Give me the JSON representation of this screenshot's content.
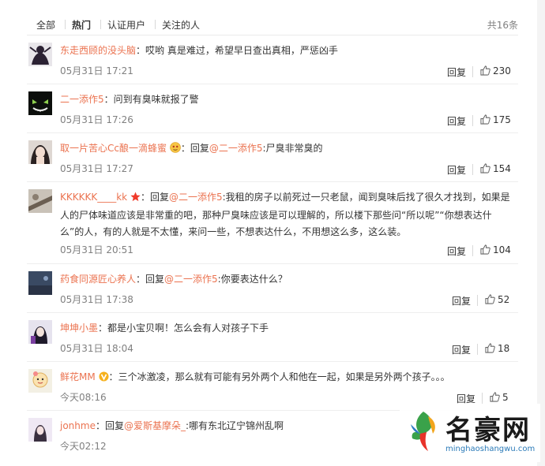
{
  "tabs": [
    {
      "label": "全部"
    },
    {
      "label": "热门"
    },
    {
      "label": "认证用户"
    },
    {
      "label": "关注的人"
    }
  ],
  "total_count": "共16条",
  "reply_label": "回复",
  "comments": [
    {
      "user": "东走西顾的没头脑",
      "prefix": "：",
      "reply_to": "",
      "text": "哎哟 真是难过，希望早日查出真相，严惩凶手",
      "time": "05月31日 17:21",
      "likes": "230",
      "badge": ""
    },
    {
      "user": "二一添作5",
      "prefix": "：",
      "reply_to": "",
      "text": "问到有臭味就报了警",
      "time": "05月31日 17:26",
      "likes": "175",
      "badge": ""
    },
    {
      "user": "取一片苦心Cc酿一滴蜂蜜",
      "prefix": "：回复",
      "reply_to": "@二一添作5",
      "text": ":尸臭非常臭的",
      "time": "05月31日 17:27",
      "likes": "154",
      "badge": "emoji"
    },
    {
      "user": "KKKKKK____kk",
      "prefix": "：回复",
      "reply_to": "@二一添作5",
      "text": ":我租的房子以前死过一只老鼠，闻到臭味后找了很久才找到，如果是人的尸体味道应该是非常重的吧，那种尸臭味应该是可以理解的，所以楼下那些问“所以呢”“你想表达什么”的人，有的人就是不太懂，来问一些，不想表达什么，不用想这么多，这么装。",
      "time": "05月31日 20:51",
      "likes": "104",
      "badge": "star"
    },
    {
      "user": "药食同源匠心养人",
      "prefix": "：回复",
      "reply_to": "@二一添作5",
      "text": ":你要表达什么？",
      "time": "05月31日 17:38",
      "likes": "52",
      "badge": ""
    },
    {
      "user": "坤坤小墨",
      "prefix": "：",
      "reply_to": "",
      "text": "都是小宝贝啊！怎么会有人对孩子下手",
      "time": "05月31日 18:04",
      "likes": "18",
      "badge": ""
    },
    {
      "user": "鲜花MM",
      "prefix": "：",
      "reply_to": "",
      "text": "三个冰激凌，那么就有可能有另外两个人和他在一起，如果是另外两个孩子。。。",
      "time": "今天08:16",
      "likes": "5",
      "badge": "v"
    },
    {
      "user": "jonhme",
      "prefix": "：回复",
      "reply_to": "@爱斯基摩朵_",
      "text": ":哪有东北辽宁锦州乱啊",
      "time": "今天02:12",
      "likes": "",
      "badge": ""
    }
  ],
  "watermark": {
    "name": "名豪网",
    "url": "minghaoshangwu.com"
  },
  "colors": {
    "accent": "#eb7350",
    "muted": "#808080",
    "divider": "#eeeeee"
  }
}
